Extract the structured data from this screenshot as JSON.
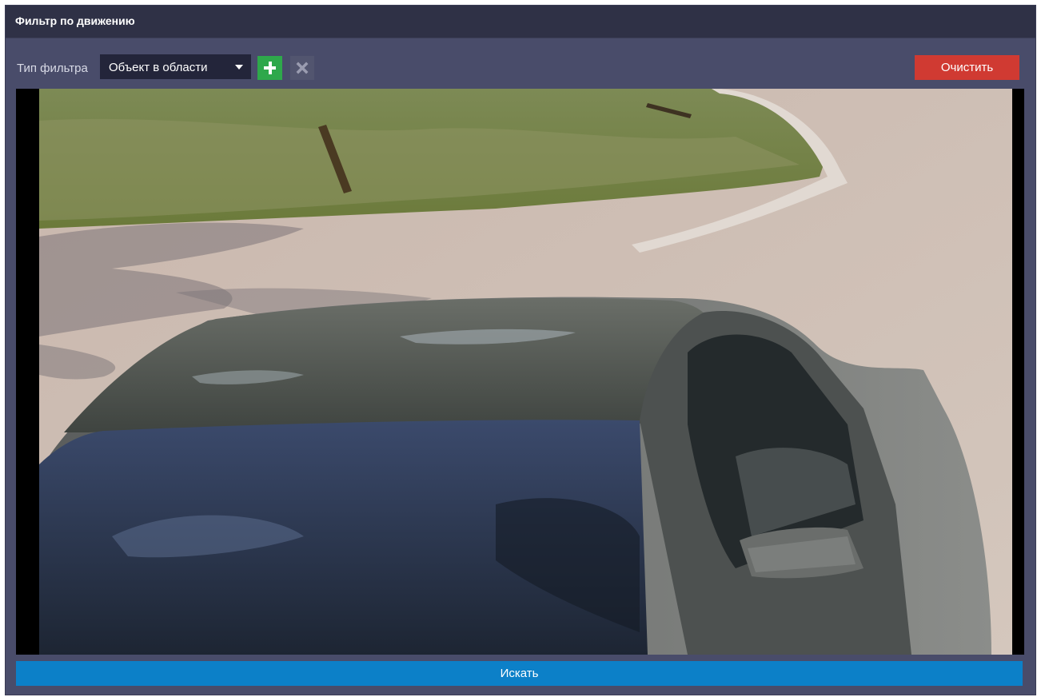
{
  "window": {
    "title": "Фильтр по движению"
  },
  "toolbar": {
    "filter_type_label": "Тип фильтра",
    "filter_type_value": "Объект в области",
    "add_icon": "plus-icon",
    "remove_icon": "close-icon",
    "clear_label": "Очистить"
  },
  "video": {
    "scene_icon": "camera-frame"
  },
  "footer": {
    "search_label": "Искать"
  },
  "colors": {
    "panel": "#494c6a",
    "titlebar": "#2f3146",
    "add_button": "#2ea84b",
    "clear_button": "#d03a32",
    "search_button": "#0c80c8"
  }
}
